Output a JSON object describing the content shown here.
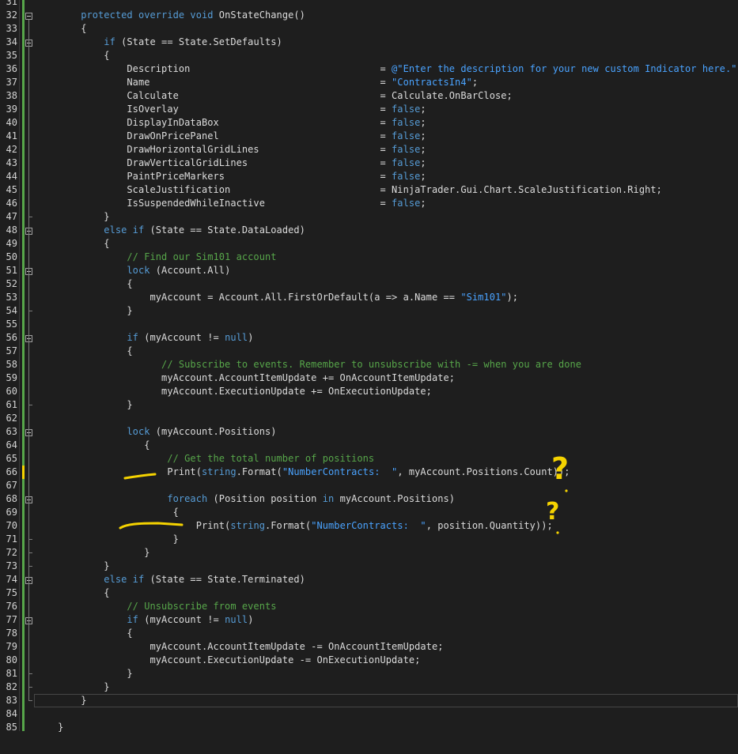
{
  "editor": {
    "lines": [
      {
        "n": "31",
        "tokens": []
      },
      {
        "n": "32",
        "tokens": [
          [
            "kw",
            "        protected override void "
          ],
          [
            "plain",
            "OnStateChange()"
          ]
        ]
      },
      {
        "n": "33",
        "tokens": [
          [
            "plain",
            "        {"
          ]
        ]
      },
      {
        "n": "34",
        "tokens": [
          [
            "kw",
            "            if "
          ],
          [
            "plain",
            "(State == State.SetDefaults)"
          ]
        ]
      },
      {
        "n": "35",
        "tokens": [
          [
            "plain",
            "            {"
          ]
        ]
      },
      {
        "n": "36",
        "tokens": [
          [
            "plain",
            "                Description                                 = "
          ],
          [
            "str",
            "@\"Enter the description for your new custom Indicator here.\""
          ],
          [
            "plain",
            ";"
          ]
        ]
      },
      {
        "n": "37",
        "tokens": [
          [
            "plain",
            "                Name                                        = "
          ],
          [
            "str",
            "\"ContractsIn4\""
          ],
          [
            "plain",
            ";"
          ]
        ]
      },
      {
        "n": "38",
        "tokens": [
          [
            "plain",
            "                Calculate                                   = Calculate.OnBarClose;"
          ]
        ]
      },
      {
        "n": "39",
        "tokens": [
          [
            "plain",
            "                IsOverlay                                   = "
          ],
          [
            "bool",
            "false"
          ],
          [
            "plain",
            ";"
          ]
        ]
      },
      {
        "n": "40",
        "tokens": [
          [
            "plain",
            "                DisplayInDataBox                            = "
          ],
          [
            "bool",
            "false"
          ],
          [
            "plain",
            ";"
          ]
        ]
      },
      {
        "n": "41",
        "tokens": [
          [
            "plain",
            "                DrawOnPricePanel                            = "
          ],
          [
            "bool",
            "false"
          ],
          [
            "plain",
            ";"
          ]
        ]
      },
      {
        "n": "42",
        "tokens": [
          [
            "plain",
            "                DrawHorizontalGridLines                     = "
          ],
          [
            "bool",
            "false"
          ],
          [
            "plain",
            ";"
          ]
        ]
      },
      {
        "n": "43",
        "tokens": [
          [
            "plain",
            "                DrawVerticalGridLines                       = "
          ],
          [
            "bool",
            "false"
          ],
          [
            "plain",
            ";"
          ]
        ]
      },
      {
        "n": "44",
        "tokens": [
          [
            "plain",
            "                PaintPriceMarkers                           = "
          ],
          [
            "bool",
            "false"
          ],
          [
            "plain",
            ";"
          ]
        ]
      },
      {
        "n": "45",
        "tokens": [
          [
            "plain",
            "                ScaleJustification                          = NinjaTrader.Gui.Chart.ScaleJustification.Right;"
          ]
        ]
      },
      {
        "n": "46",
        "tokens": [
          [
            "plain",
            "                IsSuspendedWhileInactive                    = "
          ],
          [
            "bool",
            "false"
          ],
          [
            "plain",
            ";"
          ]
        ]
      },
      {
        "n": "47",
        "tokens": [
          [
            "plain",
            "            }"
          ]
        ]
      },
      {
        "n": "48",
        "tokens": [
          [
            "kw",
            "            else if "
          ],
          [
            "plain",
            "(State == State.DataLoaded)"
          ]
        ]
      },
      {
        "n": "49",
        "tokens": [
          [
            "plain",
            "            {"
          ]
        ]
      },
      {
        "n": "50",
        "tokens": [
          [
            "com",
            "                // Find our Sim101 account"
          ]
        ]
      },
      {
        "n": "51",
        "tokens": [
          [
            "kw",
            "                lock "
          ],
          [
            "plain",
            "(Account.All)"
          ]
        ]
      },
      {
        "n": "52",
        "tokens": [
          [
            "plain",
            "                {"
          ]
        ]
      },
      {
        "n": "53",
        "tokens": [
          [
            "plain",
            "                    myAccount = Account.All.FirstOrDefault(a => a.Name == "
          ],
          [
            "str",
            "\"Sim101\""
          ],
          [
            "plain",
            ");"
          ]
        ]
      },
      {
        "n": "54",
        "tokens": [
          [
            "plain",
            "                }"
          ]
        ]
      },
      {
        "n": "55",
        "tokens": []
      },
      {
        "n": "56",
        "tokens": [
          [
            "kw",
            "                if "
          ],
          [
            "plain",
            "(myAccount != "
          ],
          [
            "kw",
            "null"
          ],
          [
            "plain",
            ")"
          ]
        ]
      },
      {
        "n": "57",
        "tokens": [
          [
            "plain",
            "                {"
          ]
        ]
      },
      {
        "n": "58",
        "tokens": [
          [
            "com",
            "                      // Subscribe to events. Remember to unsubscribe with -= when you are done"
          ]
        ]
      },
      {
        "n": "59",
        "tokens": [
          [
            "plain",
            "                      myAccount.AccountItemUpdate += OnAccountItemUpdate;"
          ]
        ]
      },
      {
        "n": "60",
        "tokens": [
          [
            "plain",
            "                      myAccount.ExecutionUpdate += OnExecutionUpdate;"
          ]
        ]
      },
      {
        "n": "61",
        "tokens": [
          [
            "plain",
            "                }"
          ]
        ]
      },
      {
        "n": "62",
        "tokens": []
      },
      {
        "n": "63",
        "tokens": [
          [
            "kw",
            "                lock "
          ],
          [
            "plain",
            "(myAccount.Positions)"
          ]
        ]
      },
      {
        "n": "64",
        "tokens": [
          [
            "plain",
            "                   {"
          ]
        ]
      },
      {
        "n": "65",
        "tokens": [
          [
            "com",
            "                       // Get the total number of positions"
          ]
        ]
      },
      {
        "n": "66",
        "tokens": [
          [
            "plain",
            "                       Print("
          ],
          [
            "kw",
            "string"
          ],
          [
            "plain",
            ".Format("
          ],
          [
            "str",
            "\"NumberContracts:  \""
          ],
          [
            "plain",
            ", myAccount.Positions.Count));"
          ]
        ]
      },
      {
        "n": "67",
        "tokens": []
      },
      {
        "n": "68",
        "tokens": [
          [
            "kw",
            "                       foreach "
          ],
          [
            "plain",
            "(Position position "
          ],
          [
            "kw",
            "in "
          ],
          [
            "plain",
            "myAccount.Positions)"
          ]
        ]
      },
      {
        "n": "69",
        "tokens": [
          [
            "plain",
            "                        {"
          ]
        ]
      },
      {
        "n": "70",
        "tokens": [
          [
            "plain",
            "                            Print("
          ],
          [
            "kw",
            "string"
          ],
          [
            "plain",
            ".Format("
          ],
          [
            "str",
            "\"NumberContracts:  \""
          ],
          [
            "plain",
            ", position.Quantity));"
          ]
        ]
      },
      {
        "n": "71",
        "tokens": [
          [
            "plain",
            "                        }"
          ]
        ]
      },
      {
        "n": "72",
        "tokens": [
          [
            "plain",
            "                   }"
          ]
        ]
      },
      {
        "n": "73",
        "tokens": [
          [
            "plain",
            "            }"
          ]
        ]
      },
      {
        "n": "74",
        "tokens": [
          [
            "kw",
            "            else if "
          ],
          [
            "plain",
            "(State == State.Terminated)"
          ]
        ]
      },
      {
        "n": "75",
        "tokens": [
          [
            "plain",
            "            {"
          ]
        ]
      },
      {
        "n": "76",
        "tokens": [
          [
            "com",
            "                // Unsubscribe from events"
          ]
        ]
      },
      {
        "n": "77",
        "tokens": [
          [
            "kw",
            "                if "
          ],
          [
            "plain",
            "(myAccount != "
          ],
          [
            "kw",
            "null"
          ],
          [
            "plain",
            ")"
          ]
        ]
      },
      {
        "n": "78",
        "tokens": [
          [
            "plain",
            "                {"
          ]
        ]
      },
      {
        "n": "79",
        "tokens": [
          [
            "plain",
            "                    myAccount.AccountItemUpdate -= OnAccountItemUpdate;"
          ]
        ]
      },
      {
        "n": "80",
        "tokens": [
          [
            "plain",
            "                    myAccount.ExecutionUpdate -= OnExecutionUpdate;"
          ]
        ]
      },
      {
        "n": "81",
        "tokens": [
          [
            "plain",
            "                }"
          ]
        ]
      },
      {
        "n": "82",
        "tokens": [
          [
            "plain",
            "            }"
          ]
        ]
      },
      {
        "n": "83",
        "tokens": [
          [
            "plain",
            "        }"
          ]
        ]
      },
      {
        "n": "84",
        "tokens": []
      },
      {
        "n": "85",
        "tokens": [
          [
            "plain",
            "    }"
          ]
        ]
      }
    ],
    "fold_markers": [
      "32",
      "34",
      "48",
      "51",
      "56",
      "63",
      "68",
      "74",
      "77"
    ],
    "annotations": {
      "marks": [
        "?",
        "?"
      ],
      "color": "#f5d300"
    },
    "colors": {
      "background": "#1e1e1e",
      "keyword": "#569cd6",
      "string": "#4aa3ff",
      "comment": "#57a64a",
      "text": "#dcdcdc",
      "gutter_change": "#57a64a"
    }
  }
}
